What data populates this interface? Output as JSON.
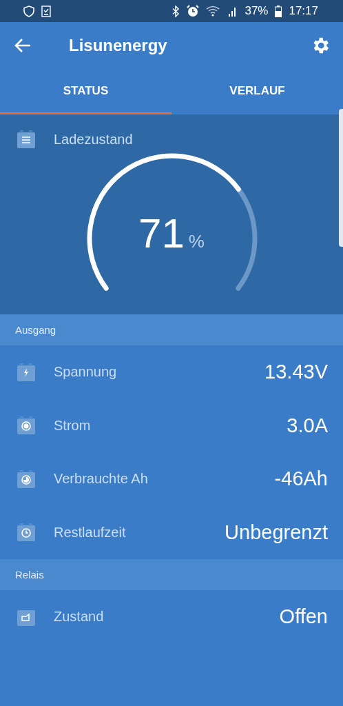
{
  "status_bar": {
    "battery_text": "37%",
    "time": "17:17"
  },
  "app_bar": {
    "title": "Lisunenergy"
  },
  "tabs": [
    {
      "label": "STATUS",
      "selected": true
    },
    {
      "label": "VERLAUF",
      "selected": false
    }
  ],
  "gauge": {
    "label": "Ladezustand",
    "value": "71",
    "unit": "%"
  },
  "sections": [
    {
      "title": "Ausgang",
      "rows": [
        {
          "kind": "bolt",
          "label": "Spannung",
          "value": "13.43V"
        },
        {
          "kind": "current",
          "label": "Strom",
          "value": "3.0A"
        },
        {
          "kind": "consumed",
          "label": "Verbrauchte Ah",
          "value": "-46Ah"
        },
        {
          "kind": "clock",
          "label": "Restlaufzeit",
          "value": "Unbegrenzt"
        }
      ]
    },
    {
      "title": "Relais",
      "rows": [
        {
          "kind": "relay",
          "label": "Zustand",
          "value": "Offen"
        }
      ]
    }
  ]
}
